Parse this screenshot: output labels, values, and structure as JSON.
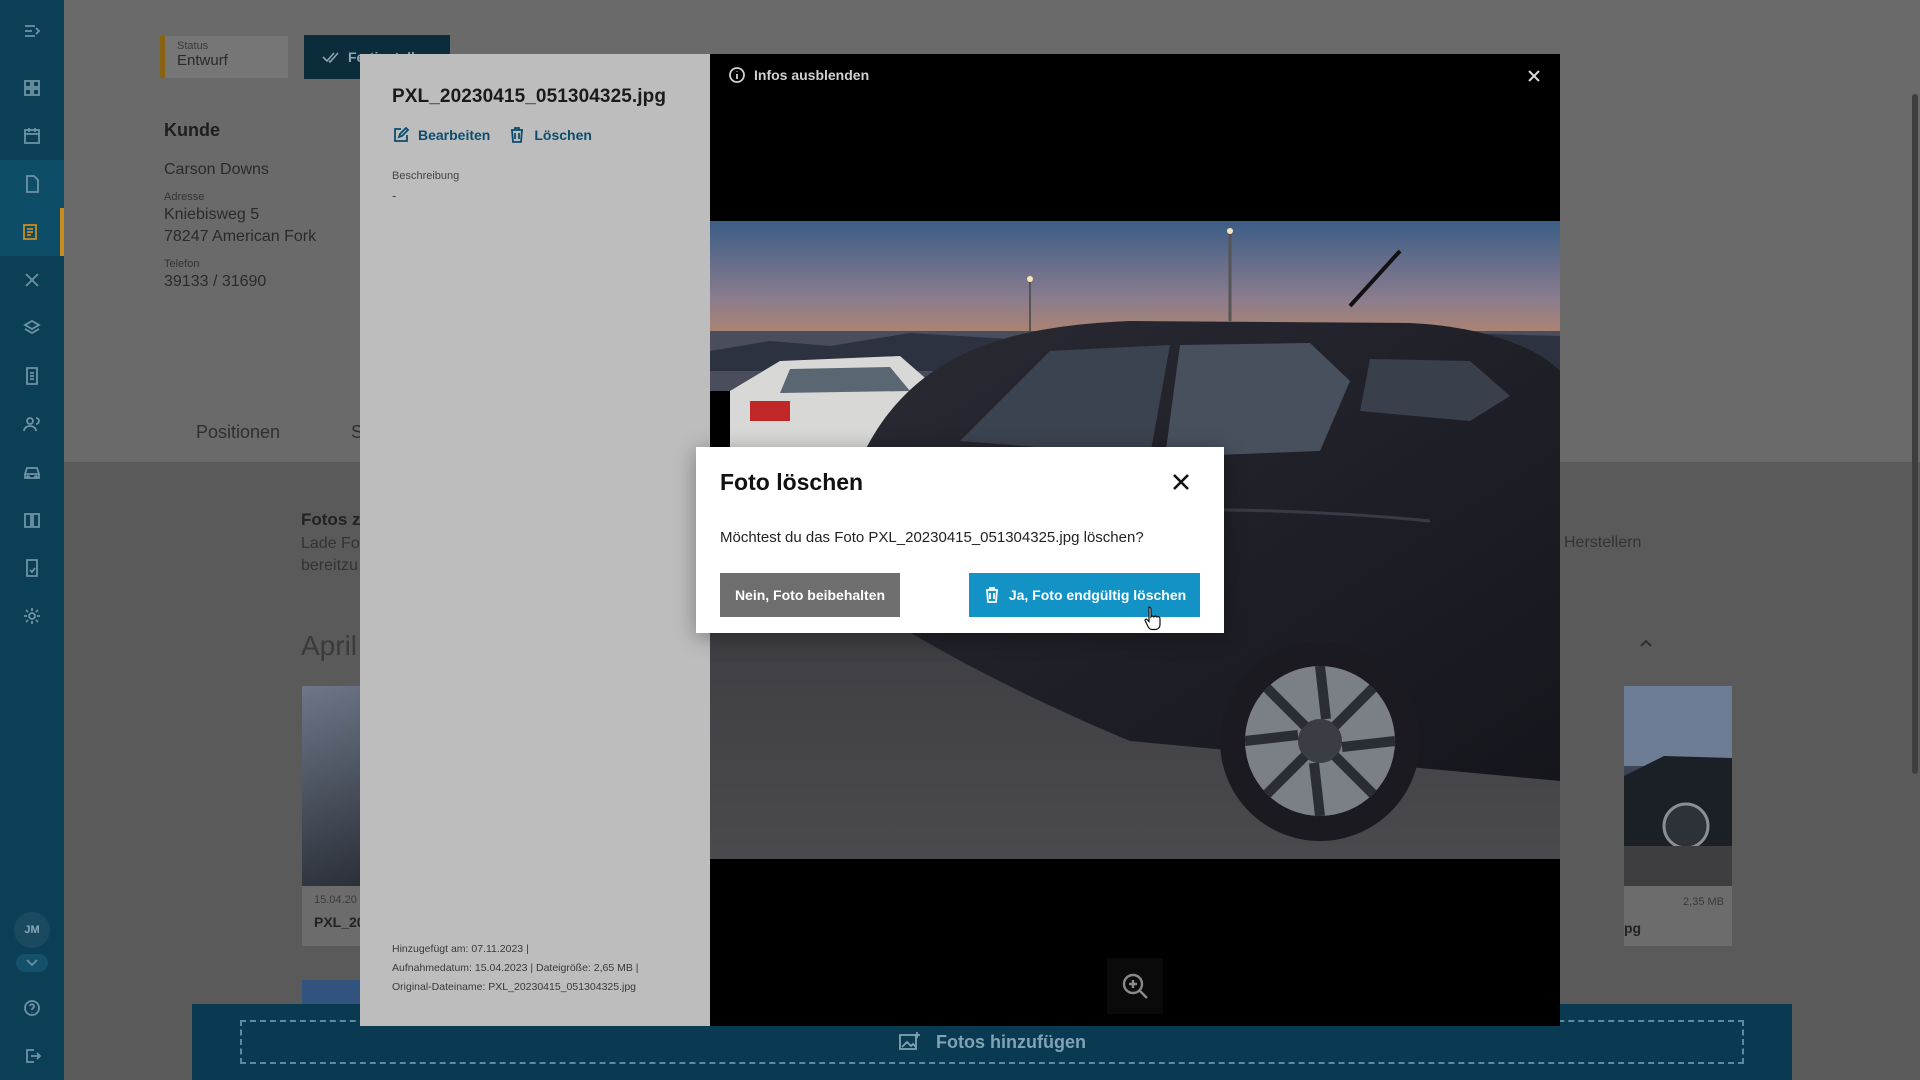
{
  "sidebar": {
    "items": [
      {
        "icon": "collapse-menu-icon"
      },
      {
        "icon": "dashboard-icon"
      },
      {
        "icon": "calendar-icon"
      },
      {
        "icon": "document-icon"
      },
      {
        "icon": "invoice-icon"
      },
      {
        "icon": "tools-icon"
      },
      {
        "icon": "layers-icon"
      },
      {
        "icon": "file-text-icon"
      },
      {
        "icon": "users-icon"
      },
      {
        "icon": "car-icon"
      },
      {
        "icon": "book-icon"
      },
      {
        "icon": "report-icon"
      },
      {
        "icon": "settings-icon"
      },
      {
        "icon": "help-icon"
      },
      {
        "icon": "logout-icon"
      }
    ],
    "avatar_initials": "JM"
  },
  "page": {
    "status_label": "Status",
    "status_value": "Entwurf",
    "finish_button": "Fertigstellen",
    "customer_title": "Kunde",
    "customer_name": "Carson Downs",
    "address_label": "Adresse",
    "address_street": "Kniebisweg 5",
    "address_city": "78247 American Fork",
    "phone_label": "Telefon",
    "phone_value": "39133 / 31690",
    "tab_positions": "Positionen",
    "tab_second": "S",
    "photos_title": "Fotos z",
    "photos_desc_1": "Lade Fot",
    "photos_desc_2": "bereitzu",
    "photos_desc_end": "Herstellern",
    "month_heading": "April",
    "card_left_date": "15.04.20",
    "card_left_name": "PXL_20",
    "card_right_size": "2,35 MB",
    "card_right_name": "pg",
    "add_photos": "Fotos hinzufügen"
  },
  "lightbox": {
    "filename": "PXL_20230415_051304325.jpg",
    "edit_label": "Bearbeiten",
    "delete_label": "Löschen",
    "description_label": "Beschreibung",
    "description_value": "-",
    "meta_added": "Hinzugefügt am: 07.11.2023 |",
    "meta_taken": "Aufnahmedatum: 15.04.2023 | Dateigröße: 2,65 MB |",
    "meta_original": "Original-Dateiname: PXL_20230415_051304325.jpg",
    "toggle_info": "Infos ausblenden"
  },
  "dialog": {
    "title": "Foto löschen",
    "message": "Möchtest du das Foto PXL_20230415_051304325.jpg löschen?",
    "keep_button": "Nein, Foto beibehalten",
    "delete_button": "Ja, Foto endgültig löschen"
  },
  "colors": {
    "sidebar_bg": "#0b3f55",
    "accent_blue": "#1392c6",
    "active_marker": "#c98c1e",
    "link_blue": "#0c4d6e"
  }
}
